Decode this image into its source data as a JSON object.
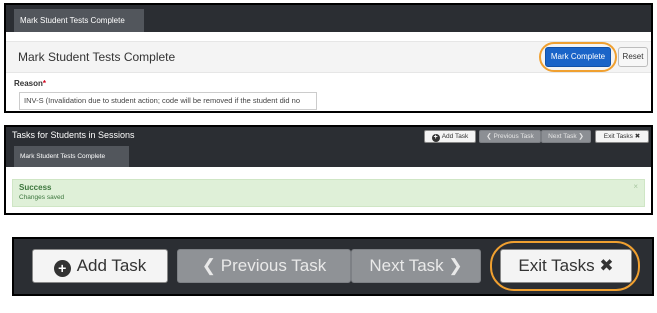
{
  "panel1": {
    "tab_label": "Mark Student Tests Complete",
    "title": "Mark Student Tests Complete",
    "mark_complete_label": "Mark Complete",
    "reset_label": "Reset",
    "reason_label": "Reason",
    "reason_required_mark": "*",
    "reason_value": "INV-S (Invalidation due to student action; code will be removed if the student did no"
  },
  "panel2": {
    "heading": "Tasks for Students in Sessions",
    "subtab_label": "Mark Student Tests Complete",
    "add_task_label": "Add Task",
    "prev_task_label": "Previous Task",
    "next_task_label": "Next Task",
    "exit_tasks_label": "Exit Tasks",
    "success_title": "Success",
    "success_message": "Changes saved",
    "close_glyph": "×"
  },
  "panel3": {
    "add_task_label": "Add Task",
    "prev_task_label": "Previous Task",
    "next_task_label": "Next Task",
    "exit_tasks_label": "Exit Tasks"
  },
  "icons": {
    "plus_circle": "plus-circle-icon",
    "chevron_left": "chevron-left-icon",
    "chevron_right": "chevron-right-icon",
    "close": "close-icon"
  },
  "colors": {
    "dark_bar": "#2b2e33",
    "tab": "#52565c",
    "primary": "#1a64c8",
    "highlight_ring": "#f0a030",
    "success_bg": "#dff0d8",
    "success_text": "#3c763d",
    "required": "#d0021b"
  }
}
